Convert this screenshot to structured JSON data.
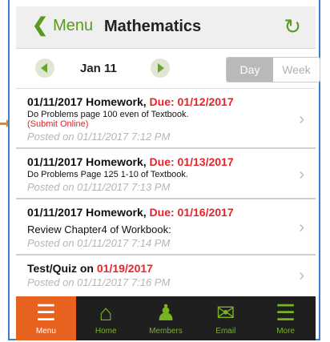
{
  "header": {
    "back_label": "Menu",
    "title": "Mathematics"
  },
  "datebar": {
    "date": "Jan 11",
    "day_label": "Day",
    "week_label": "Week"
  },
  "items": [
    {
      "title": "01/11/2017 Homework,",
      "due": "Due: 01/12/2017",
      "desc": "Do Problems page 100 even of Textbook.",
      "note": "(Submit Online)",
      "posted": "Posted on 01/11/2017 7:12 PM"
    },
    {
      "title": "01/11/2017 Homework,",
      "due": "Due: 01/13/2017",
      "desc": "Do Problems Page 125 1-10 of Textbook.",
      "note": "",
      "posted": "Posted on 01/11/2017 7:13 PM"
    },
    {
      "title": "01/11/2017 Homework,",
      "due": "Due: 01/16/2017",
      "desc": "Review Chapter4 of Workbook:",
      "note": "",
      "posted": "Posted on 01/11/2017 7:14 PM"
    },
    {
      "title": "Test/Quiz on",
      "due": "01/19/2017",
      "desc": "",
      "note": "",
      "posted": "Posted on 01/11/2017 7:16 PM"
    }
  ],
  "tabs": [
    {
      "label": "Menu",
      "icon": "menu-list-icon"
    },
    {
      "label": "Home",
      "icon": "home-icon"
    },
    {
      "label": "Members",
      "icon": "members-icon"
    },
    {
      "label": "Email",
      "icon": "email-icon"
    },
    {
      "label": "More",
      "icon": "more-list-icon"
    }
  ]
}
